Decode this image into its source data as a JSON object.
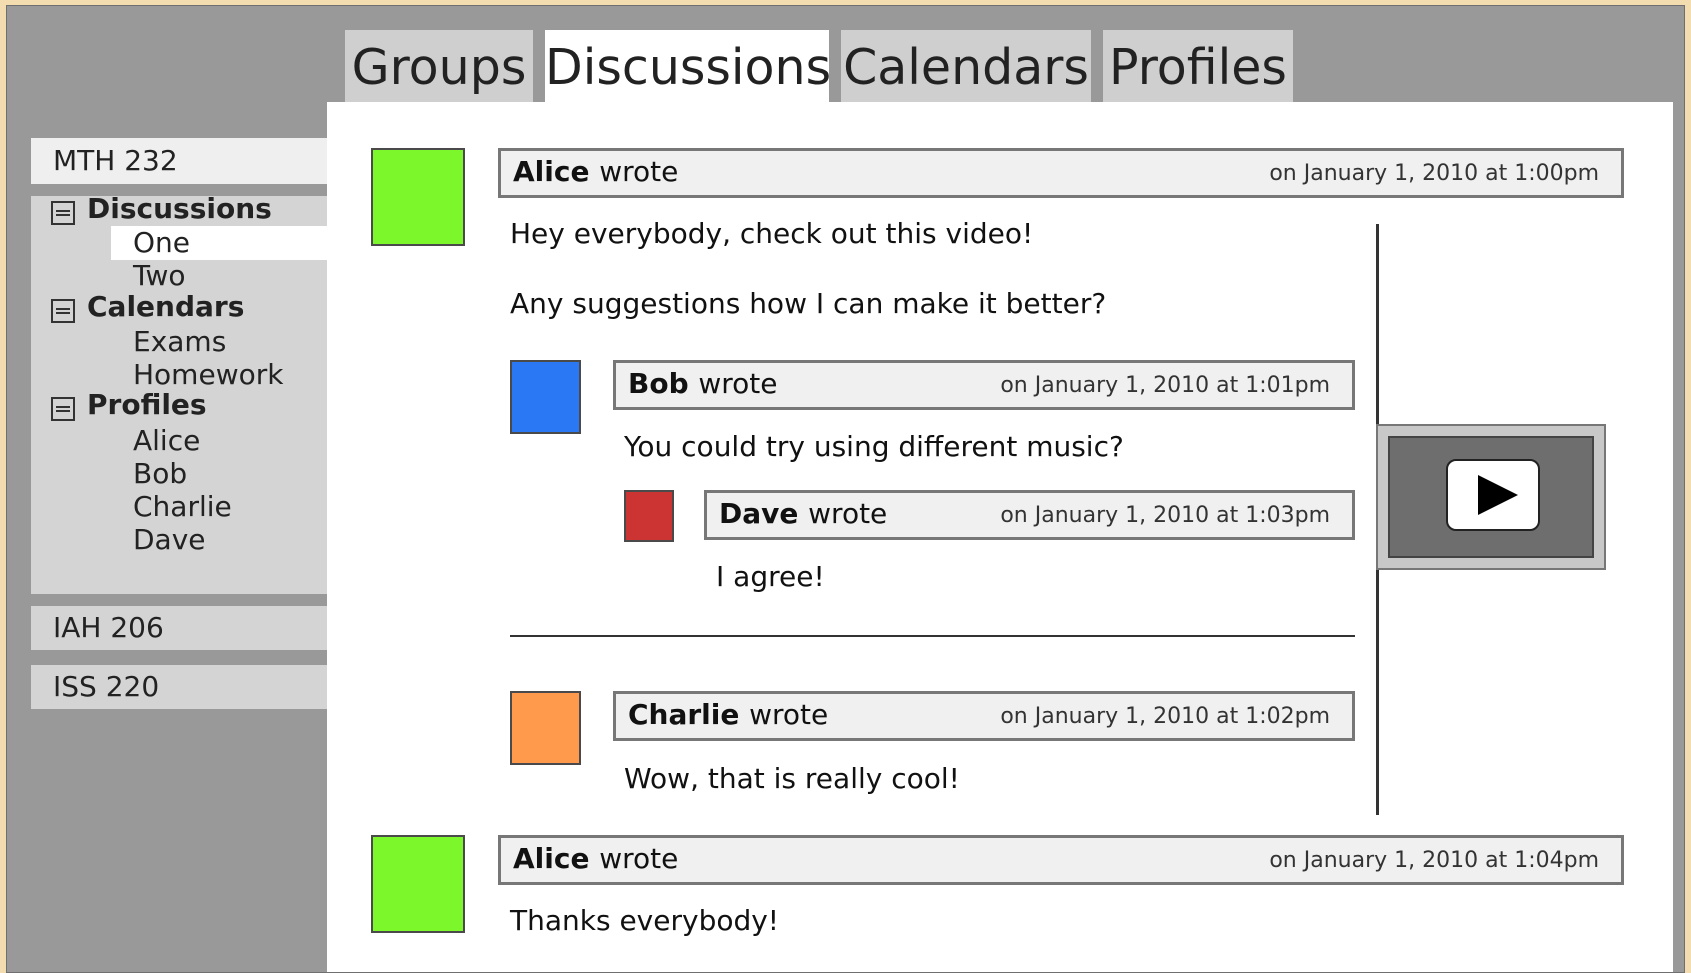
{
  "tabs": [
    "Groups",
    "Discussions",
    "Calendars",
    "Profiles"
  ],
  "sidebar": {
    "courses": [
      "MTH 232",
      "IAH 206",
      "ISS 220"
    ],
    "tree": {
      "discussions": {
        "label": "Discussions",
        "items": [
          "One",
          "Two"
        ]
      },
      "calendars": {
        "label": "Calendars",
        "items": [
          "Exams",
          "Homework"
        ]
      },
      "profiles": {
        "label": "Profiles",
        "items": [
          "Alice",
          "Bob",
          "Charlie",
          "Dave"
        ]
      }
    }
  },
  "posts": {
    "p1": {
      "author": "Alice",
      "wrote": "wrote",
      "date": "on January 1, 2010 at 1:00pm",
      "line1": "Hey everybody, check out this video!",
      "line2": "Any suggestions how I can make it better?",
      "color": "#7cf72b"
    },
    "p2": {
      "author": "Bob",
      "wrote": "wrote",
      "date": "on January 1, 2010 at 1:01pm",
      "text": "You could try using different music?",
      "color": "#2b78f5"
    },
    "p3": {
      "author": "Dave",
      "wrote": "wrote",
      "date": "on January 1, 2010 at 1:03pm",
      "text": "I agree!",
      "color": "#cc3333"
    },
    "p4": {
      "author": "Charlie",
      "wrote": "wrote",
      "date": "on January 1, 2010 at 1:02pm",
      "text": "Wow, that is really cool!",
      "color": "#ff9a4d"
    },
    "p5": {
      "author": "Alice",
      "wrote": "wrote",
      "date": "on January 1, 2010 at 1:04pm",
      "text": "Thanks everybody!",
      "color": "#7cf72b"
    }
  },
  "video": {
    "icon": "play-icon"
  }
}
